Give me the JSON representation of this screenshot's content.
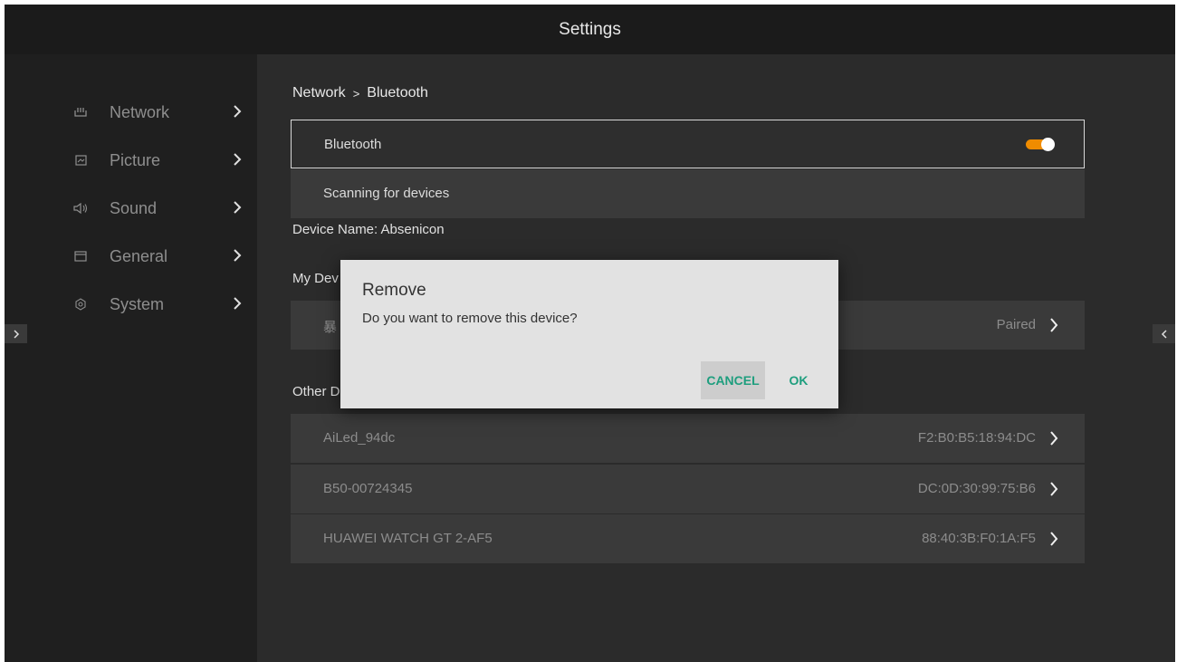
{
  "app": {
    "title": "Settings"
  },
  "sidebar": {
    "items": [
      {
        "label": "Network",
        "icon": "network-icon"
      },
      {
        "label": "Picture",
        "icon": "picture-icon"
      },
      {
        "label": "Sound",
        "icon": "sound-icon"
      },
      {
        "label": "General",
        "icon": "general-icon"
      },
      {
        "label": "System",
        "icon": "system-icon"
      }
    ]
  },
  "breadcrumb": {
    "parent": "Network",
    "separator": ">",
    "current": "Bluetooth"
  },
  "bluetooth": {
    "label": "Bluetooth",
    "enabled": true,
    "scanning_label": "Scanning for devices",
    "device_name_label": "Device Name:",
    "device_name": "Absenicon"
  },
  "my_devices": {
    "header": "My Dev",
    "items": [
      {
        "name": "暴",
        "status": "Paired"
      }
    ]
  },
  "other_devices": {
    "header": "Other D",
    "items": [
      {
        "name": "AiLed_94dc",
        "mac": "F2:B0:B5:18:94:DC"
      },
      {
        "name": "B50-00724345",
        "mac": "DC:0D:30:99:75:B6"
      },
      {
        "name": "HUAWEI WATCH GT 2-AF5",
        "mac": "88:40:3B:F0:1A:F5"
      }
    ]
  },
  "dialog": {
    "title": "Remove",
    "message": "Do you want to remove this device?",
    "cancel_label": "CANCEL",
    "ok_label": "OK"
  },
  "colors": {
    "accent_toggle": "#f08c00",
    "dialog_button_text": "#1e9e7e",
    "background": "#2b2b2b",
    "sidebar": "#1f1f1f",
    "titlebar": "#1b1b1b"
  }
}
